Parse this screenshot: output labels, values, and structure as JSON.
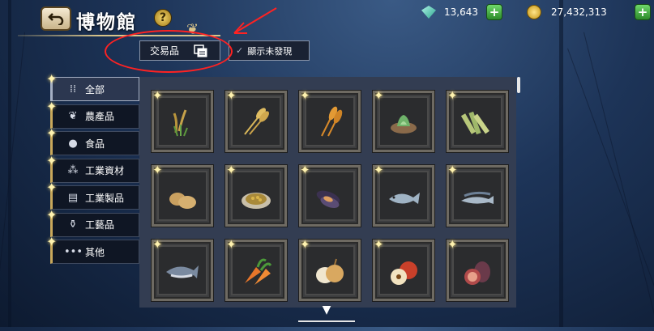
{
  "header": {
    "title": "博物館",
    "help_label": "?"
  },
  "currency": {
    "gems": {
      "icon": "gem-icon",
      "value": "13,643"
    },
    "coins": {
      "icon": "coin-icon",
      "value": "27,432,313"
    },
    "plus_label": "+"
  },
  "filters": {
    "trade_goods_label": "交易品",
    "show_undiscovered_label": "顯示未發現"
  },
  "sidebar": {
    "items": [
      {
        "label": "全部",
        "icon": "grid-dots-icon",
        "active": true
      },
      {
        "label": "農產品",
        "icon": "leaf-icon",
        "active": false
      },
      {
        "label": "食品",
        "icon": "bread-icon",
        "active": false
      },
      {
        "label": "工業資材",
        "icon": "materials-icon",
        "active": false
      },
      {
        "label": "工業製品",
        "icon": "barrel-icon",
        "active": false
      },
      {
        "label": "工藝品",
        "icon": "vase-icon",
        "active": false
      },
      {
        "label": "其他",
        "icon": "ellipsis-icon",
        "active": false
      }
    ]
  },
  "items": [
    {
      "name": "rice",
      "icon": "rice-icon"
    },
    {
      "name": "wheat",
      "icon": "wheat-icon"
    },
    {
      "name": "barley",
      "icon": "barley-icon"
    },
    {
      "name": "herbs",
      "icon": "herbs-icon"
    },
    {
      "name": "sugarcane",
      "icon": "sugarcane-icon"
    },
    {
      "name": "potato",
      "icon": "potato-icon"
    },
    {
      "name": "beans",
      "icon": "beans-icon"
    },
    {
      "name": "mussels",
      "icon": "mussel-icon"
    },
    {
      "name": "fish",
      "icon": "fish-icon"
    },
    {
      "name": "sardines",
      "icon": "sardine-icon"
    },
    {
      "name": "tuna",
      "icon": "tuna-icon"
    },
    {
      "name": "carrot",
      "icon": "carrot-icon"
    },
    {
      "name": "onion",
      "icon": "onion-icon"
    },
    {
      "name": "apple",
      "icon": "apple-icon"
    },
    {
      "name": "fig",
      "icon": "fig-icon"
    }
  ],
  "colors": {
    "annotation": "#ff2222",
    "gem": "#3fbfa5",
    "coin": "#e0b22a",
    "plus_button": "#3fae3c",
    "sparkle": "#fff3b0"
  }
}
